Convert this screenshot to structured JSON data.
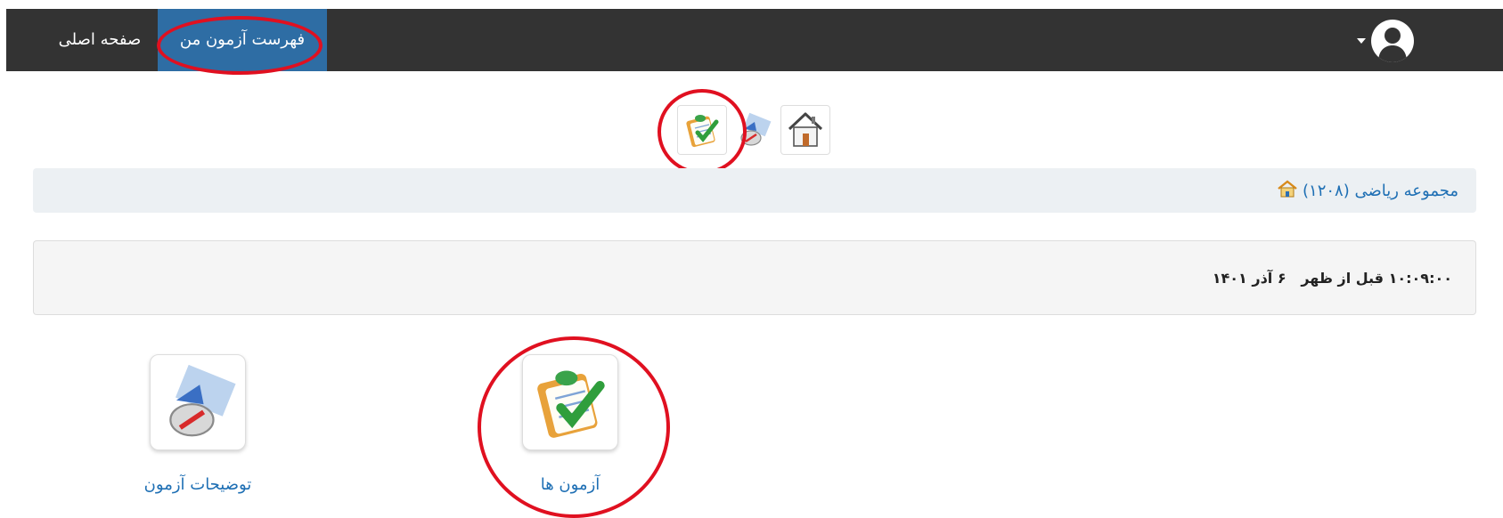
{
  "navbar": {
    "home_label": "صفحه اصلی",
    "active_label": "فهرست آزمون من",
    "user_icon": "user-avatar-icon"
  },
  "toolbar": {
    "icons": [
      "exam-checklist-icon",
      "compass-map-icon",
      "house-icon"
    ]
  },
  "breadcrumb": {
    "label": "مجموعه ریاضی (۱۲۰۸)",
    "icon": "home-icon"
  },
  "datetime": {
    "text": "۱۰:۰۹:۰۰ قبل از ظهر   ۶ آذر ۱۴۰۱"
  },
  "tiles": [
    {
      "label": "آزمون ها",
      "icon": "exam-checklist-icon"
    },
    {
      "label": "توضیحات آزمون",
      "icon": "compass-map-icon"
    }
  ],
  "colors": {
    "navbar_bg": "#333333",
    "nav_active_bg": "#2e6da4",
    "link": "#1e6fb4",
    "annotation": "#e01020"
  }
}
